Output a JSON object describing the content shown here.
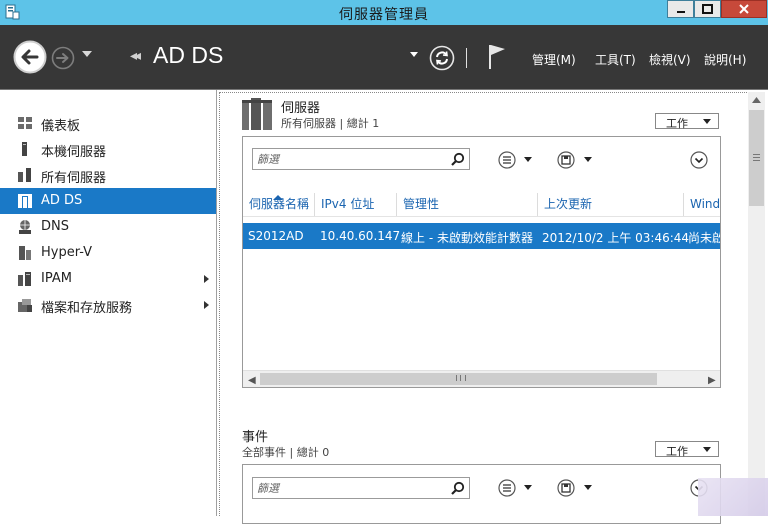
{
  "window": {
    "title": "伺服器管理員"
  },
  "header": {
    "breadcrumb": "AD DS",
    "menus": [
      "管理(M)",
      "工具(T)",
      "檢視(V)",
      "說明(H)"
    ]
  },
  "sidebar": {
    "items": [
      {
        "label": "儀表板",
        "icon": "dashboard-icon"
      },
      {
        "label": "本機伺服器",
        "icon": "local-server-icon"
      },
      {
        "label": "所有伺服器",
        "icon": "all-servers-icon"
      },
      {
        "label": "AD DS",
        "icon": "ad-ds-icon",
        "active": true
      },
      {
        "label": "DNS",
        "icon": "dns-icon"
      },
      {
        "label": "Hyper-V",
        "icon": "hyper-v-icon"
      },
      {
        "label": "IPAM",
        "icon": "ipam-icon",
        "expandable": true
      },
      {
        "label": "檔案和存放服務",
        "icon": "file-storage-icon",
        "expandable": true
      }
    ]
  },
  "servers": {
    "title": "伺服器",
    "subtitle": "所有伺服器 | 總計 1",
    "tasks_label": "工作",
    "filter_placeholder": "篩選",
    "columns": [
      "伺服器名稱",
      "IPv4 位址",
      "管理性",
      "上次更新",
      "Wind"
    ],
    "rows": [
      [
        "S2012AD",
        "10.40.60.147",
        "線上 - 未啟動效能計數器",
        "2012/10/2 上午 03:46:44",
        "尚未啟"
      ]
    ]
  },
  "events": {
    "title": "事件",
    "subtitle": "全部事件 | 總計 0",
    "tasks_label": "工作",
    "filter_placeholder": "篩選"
  },
  "colors": {
    "titlebar": "#5dc3e8",
    "header": "#373737",
    "selection": "#1a79c7",
    "column_header_text": "#1a64b0"
  }
}
